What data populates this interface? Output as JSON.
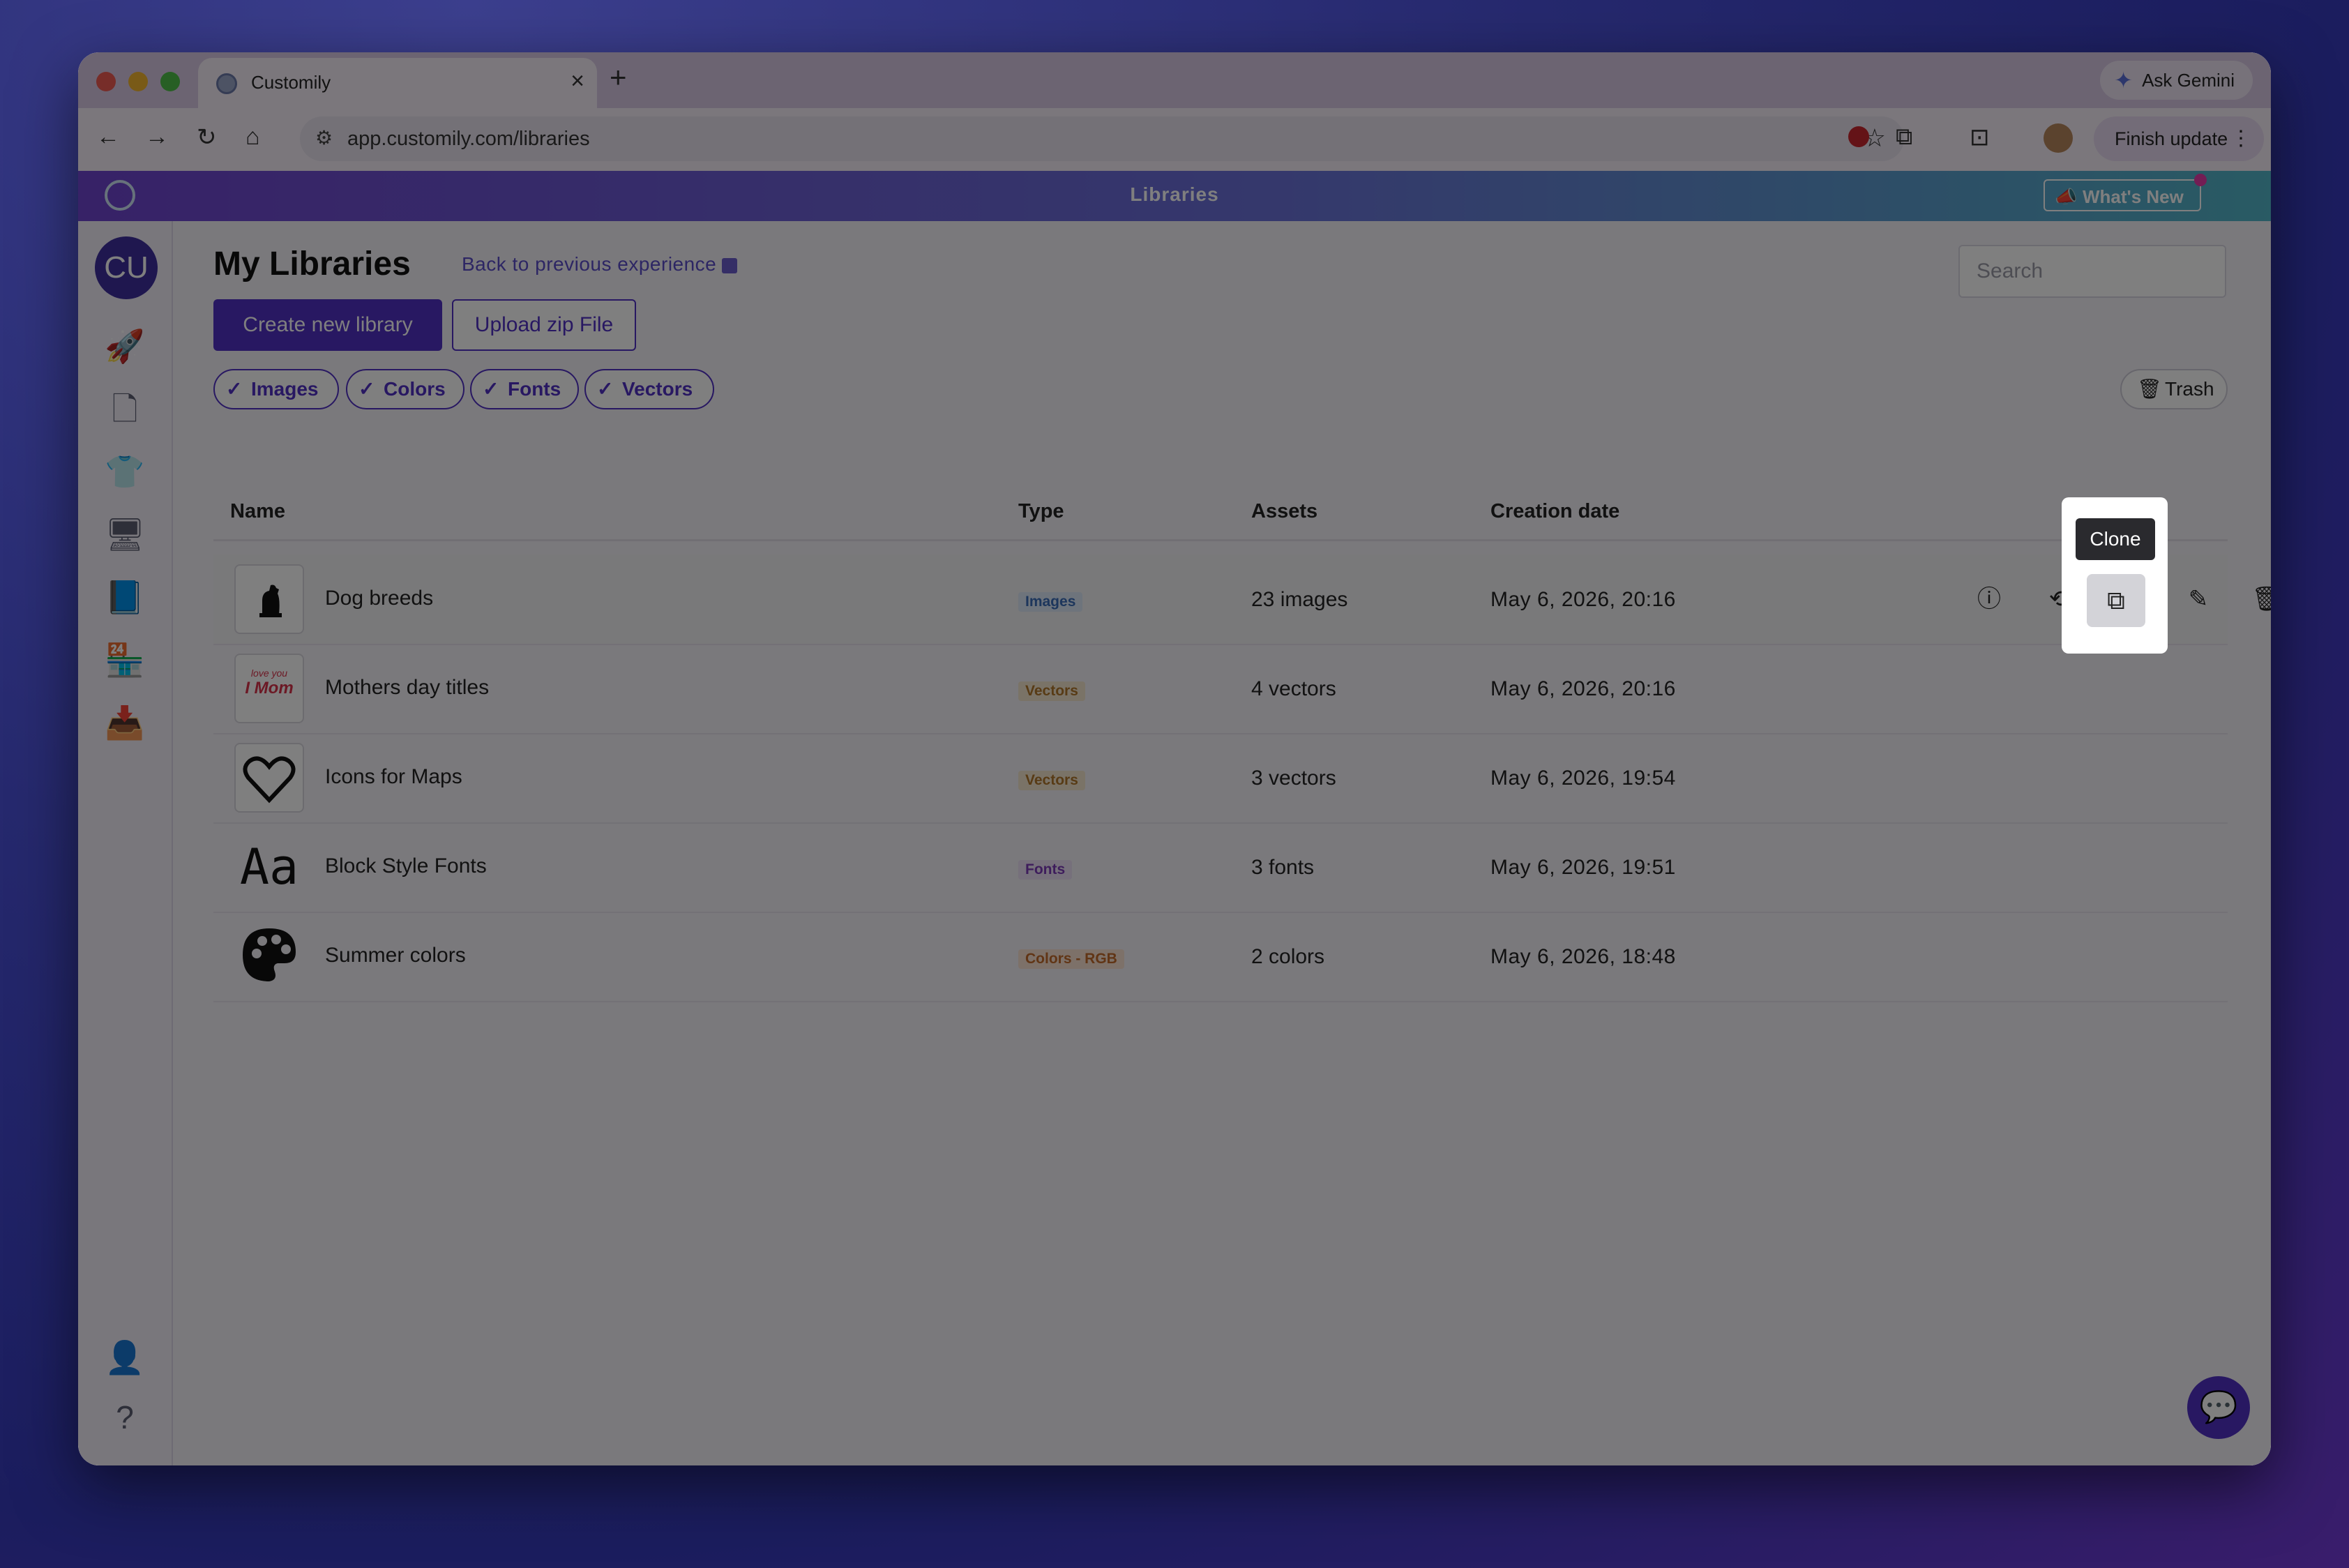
{
  "browser": {
    "tab_title": "Customily",
    "tab_close": "×",
    "new_tab": "+",
    "ask_gemini": "Ask Gemini",
    "url": "app.customily.com/libraries",
    "finish_update": "Finish update"
  },
  "app": {
    "header_title": "Libraries",
    "whats_new": "What's New",
    "user_initials": "CU"
  },
  "page": {
    "title": "My Libraries",
    "back_link": "Back to previous experience",
    "search_placeholder": "Search",
    "create_button": "Create new library",
    "upload_button": "Upload zip File",
    "trash_button": "Trash",
    "filters": [
      "Images",
      "Colors",
      "Fonts",
      "Vectors"
    ]
  },
  "table": {
    "columns": [
      "Name",
      "Type",
      "Assets",
      "Creation date"
    ],
    "rows": [
      {
        "name": "Dog breeds",
        "type": "Images",
        "assets": "23 images",
        "date": "May 6, 2026, 20:16"
      },
      {
        "name": "Mothers day titles",
        "type": "Vectors",
        "assets": "4 vectors",
        "date": "May 6, 2026, 20:16"
      },
      {
        "name": "Icons for Maps",
        "type": "Vectors",
        "assets": "3 vectors",
        "date": "May 6, 2026, 19:54"
      },
      {
        "name": "Block Style Fonts",
        "type": "Fonts",
        "assets": "3 fonts",
        "date": "May 6, 2026, 19:51"
      },
      {
        "name": "Summer colors",
        "type": "Colors - RGB",
        "assets": "2 colors",
        "date": "May 6, 2026, 18:48"
      }
    ]
  },
  "thumb_text": {
    "mothers_line1": "love you",
    "mothers_line2": "I Mom",
    "fonts_sample": "Aa"
  },
  "tooltip": {
    "clone": "Clone"
  },
  "colors": {
    "brand_purple": "#5030c4",
    "header_gradient_start": "#6f44cf",
    "header_gradient_end": "#52b6c8"
  }
}
